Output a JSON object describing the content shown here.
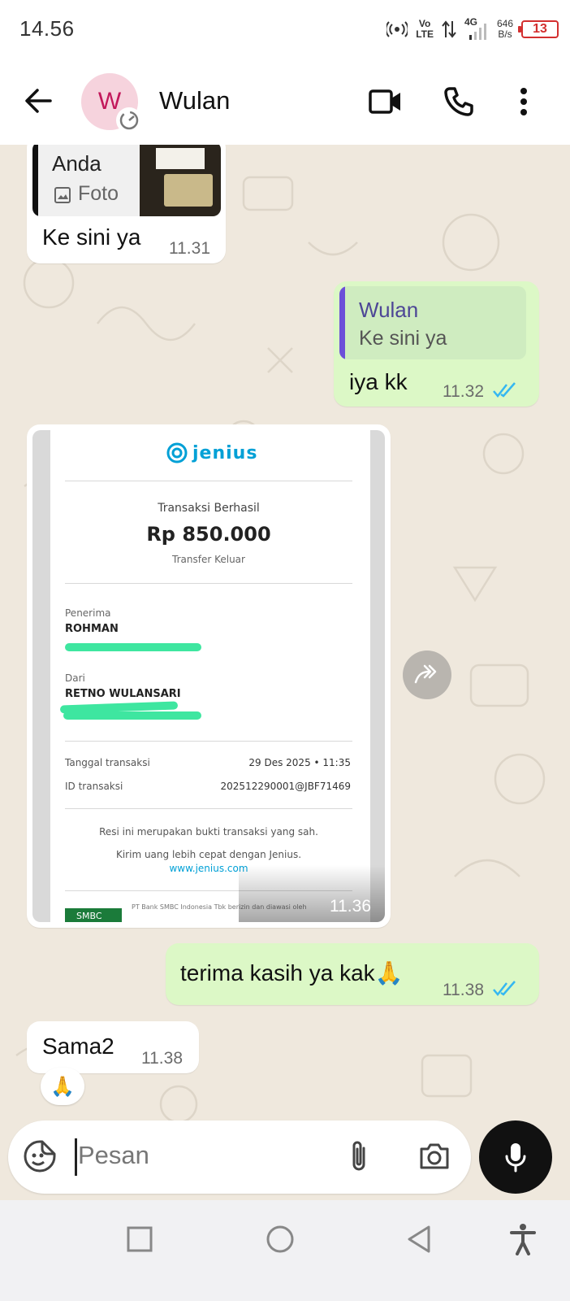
{
  "status_bar": {
    "time": "14.56",
    "network_top": "Vo",
    "network_bottom": "LTE",
    "gen": "4G",
    "speed_value": "646",
    "speed_unit": "B/s",
    "battery": "13",
    "battery_color": "#d32f2f"
  },
  "header": {
    "avatar_initial": "W",
    "contact_name": "Wulan"
  },
  "messages": {
    "m1": {
      "quote_author": "Anda",
      "quote_type": "Foto",
      "text": "Ke sini ya",
      "time": "11.31"
    },
    "m2": {
      "quote_author": "Wulan",
      "quote_text": "Ke sini ya",
      "text": "iya kk",
      "time": "11.32"
    },
    "m3": {
      "time": "11.36"
    },
    "m4": {
      "text": "terima kasih ya kak🙏",
      "time": "11.38"
    },
    "m5": {
      "text": "Sama2",
      "time": "11.38",
      "reaction": "🙏"
    }
  },
  "receipt": {
    "brand": "jenius",
    "status": "Transaksi Berhasil",
    "amount": "Rp 850.000",
    "type": "Transfer Keluar",
    "recipient_label": "Penerima",
    "recipient_name": "ROHMAN",
    "sender_label": "Dari",
    "sender_name": "RETNO WULANSARI",
    "date_label": "Tanggal transaksi",
    "date_value": "29 Des 2025 • 11:35",
    "id_label": "ID transaksi",
    "id_value": "202512290001@JBF71469",
    "note1": "Resi ini merupakan bukti transaksi yang sah.",
    "note2": "Kirim uang lebih cepat dengan Jenius.",
    "link": "www.jenius.com",
    "footer_logo": "SMBC",
    "footer_text": "PT Bank SMBC Indonesia Tbk berizin dan diawasi oleh"
  },
  "composer": {
    "placeholder": "Pesan"
  },
  "colors": {
    "chat_bg": "#efe8dd",
    "outgoing_bubble": "#dcf8c6",
    "incoming_bubble": "#ffffff",
    "read_ticks": "#34b7f1",
    "quote_bar": "#6c4ed9",
    "jenius_blue": "#00a0d6"
  },
  "icons": [
    "back-arrow-icon",
    "video-call-icon",
    "phone-icon",
    "more-vertical-icon",
    "sticker-icon",
    "attach-icon",
    "camera-icon",
    "mic-icon",
    "forward-icon",
    "read-ticks-icon"
  ]
}
